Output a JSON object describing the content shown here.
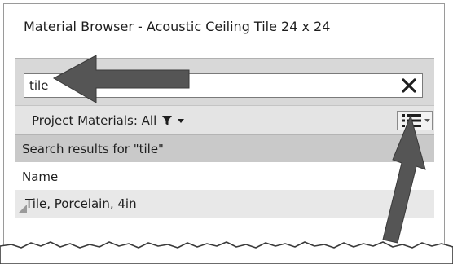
{
  "window": {
    "title": "Material Browser - Acoustic Ceiling Tile 24 x 24"
  },
  "search": {
    "value": "tile",
    "clear_icon": "close-x-icon"
  },
  "filter": {
    "label": "Project Materials: All",
    "filter_icon": "funnel-icon",
    "dropdown_icon": "caret-down-icon",
    "view_icon": "list-view-icon"
  },
  "results": {
    "header": "Search results for \"tile\"",
    "column_name": "Name",
    "items": [
      {
        "label": "Tile, Porcelain, 4in",
        "icon": "material-swatch-icon"
      }
    ]
  },
  "annotations": {
    "arrow_color": "#555555",
    "arrow_icon": "callout-arrow-icon"
  }
}
